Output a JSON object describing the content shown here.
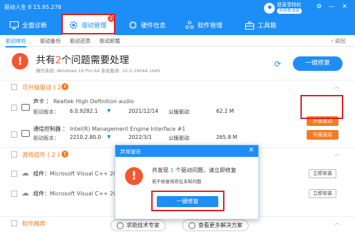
{
  "window": {
    "title": "驱动人生 8 15.95.278",
    "login_main": "登录享特权",
    "login_sub": "你有新消息",
    "controls": [
      "⚙",
      "—",
      "✕"
    ]
  },
  "nav": {
    "items": [
      {
        "label": "全面诊断"
      },
      {
        "label": "驱动管理",
        "badge": "2"
      },
      {
        "label": "硬件信息"
      },
      {
        "label": "软件管理"
      },
      {
        "label": "工具箱"
      }
    ]
  },
  "subtabs": {
    "items": [
      "驱动体检",
      "驱动备份",
      "驱动还原",
      "驱动卸载"
    ],
    "return_label": "‹ 返回"
  },
  "summary": {
    "title_pre": "共有",
    "count": "2",
    "title_post": "个问题需要处理",
    "os_info": "操作系统: Windows 10 Pro 64     系统版本: 10.0.19044.1645",
    "fix_all_label": "一键修复"
  },
  "sections": {
    "upgradable": {
      "label": "可升级驱动 ( 2 )",
      "warn": "!"
    },
    "game": {
      "label": "游戏组件 ( 2 )",
      "warn": "!"
    },
    "recommend": {
      "label": "软件推荐"
    }
  },
  "drivers": [
    {
      "type": "声卡",
      "name": "Realtek High Definition audio",
      "version_label": "驱动版本：",
      "version": "6.0.9282.1",
      "date": "2021/12/14",
      "vendor": "公版驱动",
      "size": "62.2 M",
      "action": "升级驱动"
    },
    {
      "type": "通信控制器",
      "name": "Intel(R) Management Engine Interface #1",
      "version_label": "驱动版本：",
      "version": "2210.2.80.0",
      "date": "2022/3/1",
      "vendor": "公版驱动",
      "size": "265.8 M",
      "action": "升级驱动"
    }
  ],
  "components": [
    {
      "label": "组件：",
      "name": "Microsoft Visual C++ 2015-20",
      "action": "立即安装"
    },
    {
      "label": "组件：",
      "name": "Microsoft Visual C++ 2015-20",
      "action": "立即安装"
    }
  ],
  "bottom": {
    "help_label": "求助技术专家",
    "more_label": "查看更多解决方案"
  },
  "dialog": {
    "title": "异常提示",
    "close": "✕",
    "msg_pre": "共发现 ",
    "msg_count": "1",
    "msg_post": " 个驱动问题，请立即修复",
    "sub": "若不修复将存在未知问题",
    "fix_label": "一键修复"
  },
  "colors": {
    "primary": "#1e8ef7",
    "warning": "#f47b20",
    "alert": "#f4572f",
    "highlight": "#e11c1c"
  }
}
